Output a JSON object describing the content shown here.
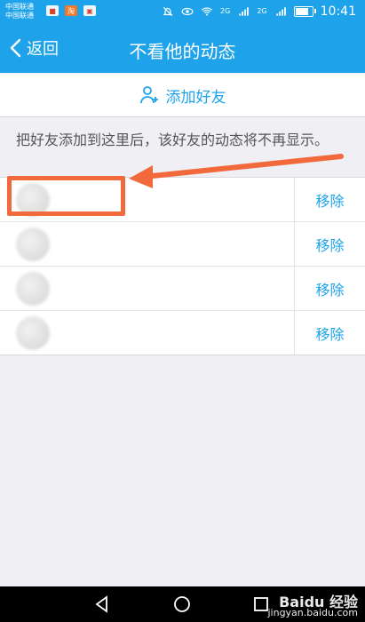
{
  "status_bar": {
    "carrier_1": "中国联通",
    "carrier_2": "中国联通",
    "signal_label_1": "2G",
    "signal_label_2": "2G",
    "time": "10:41",
    "battery_level": 0.8
  },
  "header": {
    "back_label": "返回",
    "title": "不看他的动态"
  },
  "actions": {
    "add_friend_label": "添加好友"
  },
  "notice": {
    "text": "把好友添加到这里后，该好友的动态将不再显示。"
  },
  "friends": [
    {
      "name": "",
      "remove_label": "移除"
    },
    {
      "name": "",
      "remove_label": "移除"
    },
    {
      "name": "",
      "remove_label": "移除"
    },
    {
      "name": "",
      "remove_label": "移除"
    }
  ],
  "watermark": {
    "brand": "Baidu 经验",
    "url": "jingyan.baidu.com"
  },
  "colors": {
    "header": "#1ea3ea",
    "annotation": "#f26a3c"
  }
}
